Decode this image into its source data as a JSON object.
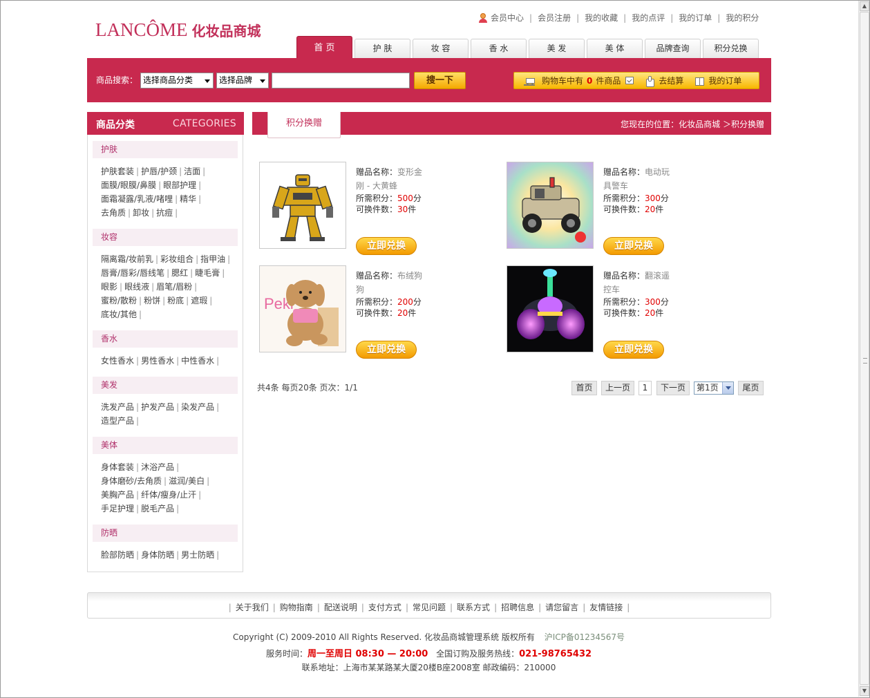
{
  "logo": {
    "brand": "LANCÔME",
    "brand_cn": "化妆品商城"
  },
  "top_links": [
    "会员中心",
    "会员注册",
    "我的收藏",
    "我的点评",
    "我的订单",
    "我的积分"
  ],
  "nav_tabs": [
    "首 页",
    "护 肤",
    "妆 容",
    "香 水",
    "美 发",
    "美 体",
    "品牌查询",
    "积分兑换"
  ],
  "search": {
    "label": "商品搜索：",
    "category_select": "选择商品分类",
    "brand_select": "选择品牌",
    "keyword_value": "",
    "button": "搜一下"
  },
  "cart": {
    "prefix": "购物车中有",
    "count": "0",
    "suffix": "件商品",
    "checkout": "去结算",
    "my_orders": "我的订单"
  },
  "sidebar": {
    "title": "商品分类",
    "title_en": "CATEGORIES",
    "categories": [
      {
        "name": "护肤",
        "items": [
          "护肤套装",
          "护唇/护颈",
          "洁面",
          "面膜/眼膜/鼻膜",
          "眼部护理",
          "面霜凝露/乳液/啫哩",
          "精华",
          "去角质",
          "卸妆",
          "抗痘"
        ]
      },
      {
        "name": "妆容",
        "items": [
          "隔离霜/妆前乳",
          "彩妆组合",
          "指甲油",
          "唇膏/唇彩/唇线笔",
          "腮红",
          "睫毛膏",
          "眼影",
          "眼线液",
          "眉笔/眉粉",
          "蜜粉/散粉",
          "粉饼",
          "粉底",
          "遮瑕",
          "底妆/其他"
        ]
      },
      {
        "name": "香水",
        "items": [
          "女性香水",
          "男性香水",
          "中性香水"
        ]
      },
      {
        "name": "美发",
        "items": [
          "洗发产品",
          "护发产品",
          "染发产品",
          "造型产品"
        ]
      },
      {
        "name": "美体",
        "items": [
          "身体套装",
          "沐浴产品",
          "身体磨砂/去角质",
          "滋润/美白",
          "美胸产品",
          "纤体/瘦身/止汗",
          "手足护理",
          "脱毛产品"
        ]
      },
      {
        "name": "防晒",
        "items": [
          "脸部防晒",
          "身体防晒",
          "男士防晒"
        ]
      }
    ]
  },
  "content": {
    "tab": "积分换赠",
    "breadcrumb": "您现在的位置：化妆品商城 ＞积分换赠",
    "name_label": "赠品名称：",
    "points_label": "所需积分：",
    "qty_label": "可换件数：",
    "points_unit": "分",
    "qty_unit": "件",
    "exchange_button": "立即兑换",
    "products": [
      {
        "name1": "变形金",
        "name2": "刚 - 大黄蜂",
        "points": "500",
        "qty": "30",
        "image": "robot-toy"
      },
      {
        "name1": "电动玩",
        "name2": "具警车",
        "points": "300",
        "qty": "20",
        "image": "toy-police-car"
      },
      {
        "name1": "布绒狗",
        "name2": "狗",
        "points": "200",
        "qty": "20",
        "image": "plush-dog"
      },
      {
        "name1": "翻滚遥",
        "name2": "控车",
        "points": "300",
        "qty": "20",
        "image": "rc-stunt-car"
      }
    ]
  },
  "pagination": {
    "info": "共4条  每页20条  页次：1/1",
    "first": "首页",
    "prev": "上一页",
    "current": "1",
    "next": "下一页",
    "select": "第1页",
    "last": "尾页"
  },
  "footer": {
    "links": [
      "关于我们",
      "购物指南",
      "配送说明",
      "支付方式",
      "常见问题",
      "联系方式",
      "招聘信息",
      "请您留言",
      "友情链接"
    ],
    "copyright": "Copyright (C) 2009-2010 All Rights Reserved. 化妆品商城管理系统 版权所有",
    "icp": "沪ICP备01234567号",
    "service_label": "服务时间：",
    "service_days": "周一至周日 08:30 — 20:00",
    "hotline_label": "全国订购及服务热线：",
    "hotline": "021-98765432",
    "address": "联系地址：上海市某某路某大厦20楼B座2008室  邮政编码：210000"
  },
  "colors": {
    "brand": "#c8294e",
    "price": "#e00000",
    "button": "#f5a800"
  }
}
